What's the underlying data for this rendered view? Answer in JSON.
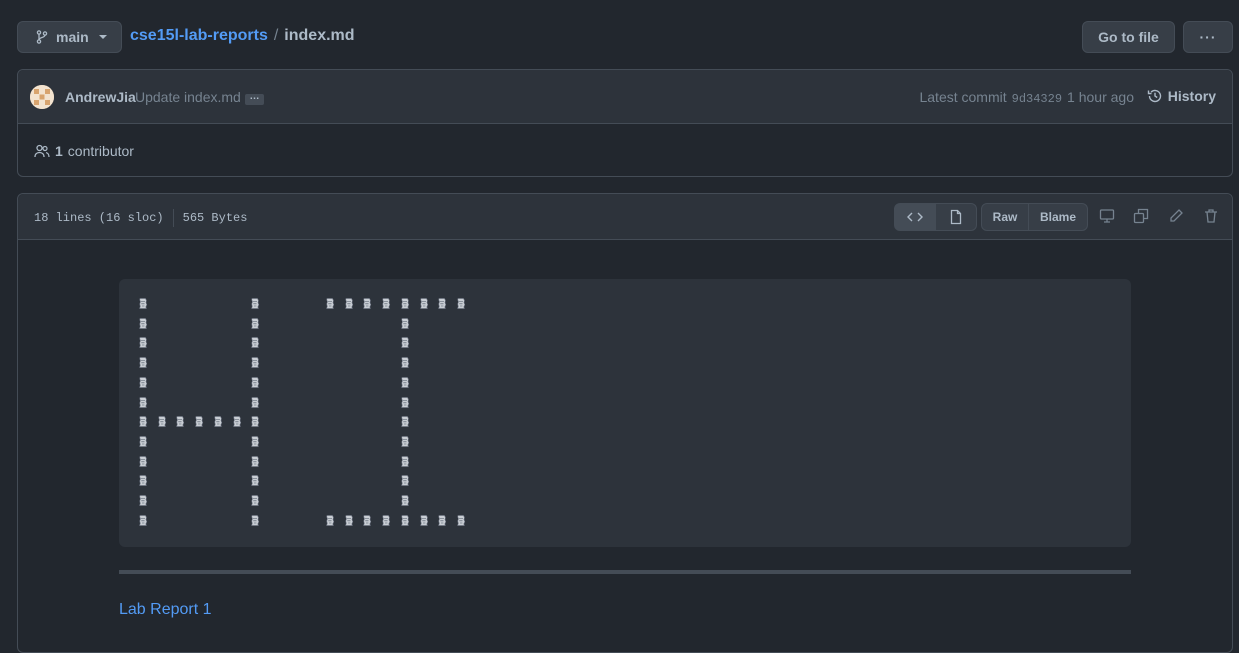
{
  "branch": {
    "label": "main"
  },
  "breadcrumb": {
    "repo": "cse15l-lab-reports",
    "separator": "/",
    "file": "index.md"
  },
  "toolbar": {
    "goto_label": "Go to file",
    "more_label": "···"
  },
  "commit": {
    "author": "AndrewJia",
    "message": "Update index.md",
    "ellipsis": "…",
    "latest_label": "Latest commit",
    "sha": "9d34329",
    "time": "1 hour ago",
    "history_label": "History"
  },
  "contributors": {
    "count": "1",
    "label": "contributor"
  },
  "file": {
    "lines": "18 lines (16 sloc)",
    "size": "565 Bytes",
    "raw_label": "Raw",
    "blame_label": "Blame"
  },
  "content": {
    "art_rows": [
      "🗿     🗿   🗿🗿🗿🗿🗿🗿🗿🗿",
      "🗿     🗿       🗿",
      "🗿     🗿       🗿",
      "🗿     🗿       🗿",
      "🗿     🗿       🗿",
      "🗿     🗿       🗿",
      "🗿🗿🗿🗿🗿🗿🗿       🗿",
      "🗿     🗿       🗿",
      "🗿     🗿       🗿",
      "🗿     🗿       🗿",
      "🗿     🗿       🗿",
      "🗿     🗿   🗿🗿🗿🗿🗿🗿🗿🗿"
    ],
    "link_label": "Lab Report 1"
  },
  "colors": {
    "background": "#22272e",
    "panel": "#2d333b",
    "border": "#444c56",
    "link": "#539bf5",
    "text": "#adbac7"
  },
  "icons": [
    "git-branch-icon",
    "caret-down-icon",
    "kebab-icon",
    "history-icon",
    "people-icon",
    "code-icon",
    "file-icon",
    "desktop-icon",
    "copy-icon",
    "pencil-icon",
    "trash-icon",
    "moai-icon"
  ]
}
